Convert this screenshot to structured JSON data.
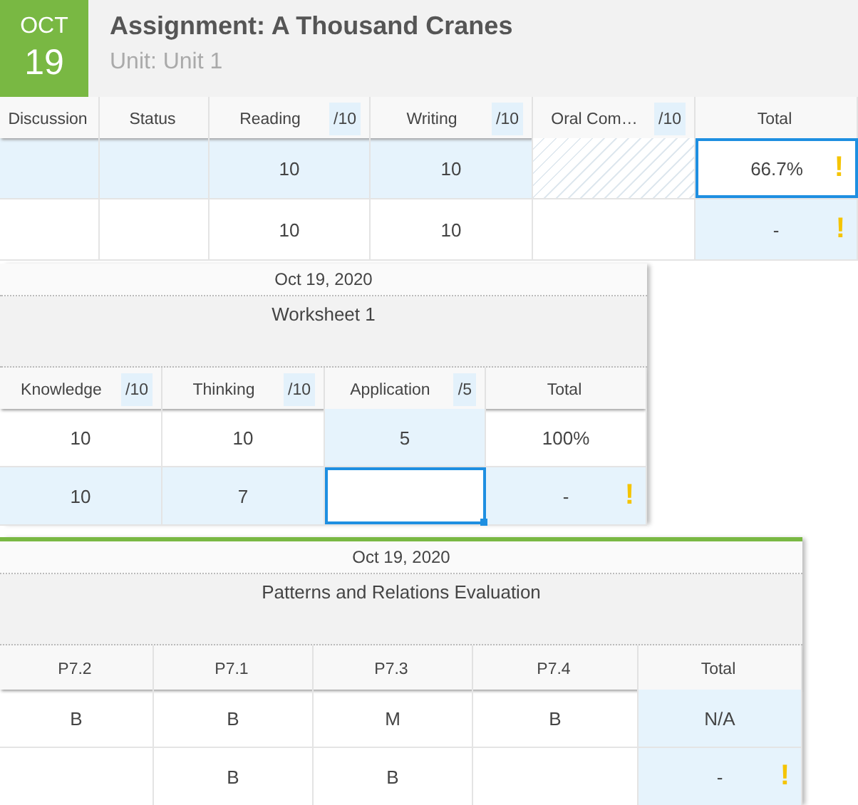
{
  "panels": [
    {
      "kind": "assignment",
      "selected": false,
      "month": "OCT",
      "day": "19",
      "title": "Assignment: A Thousand Cranes",
      "subtitle": "Unit: Unit 1",
      "columns": [
        {
          "label": "Discussion"
        },
        {
          "label": "Status"
        },
        {
          "label": "Reading",
          "max": "/10"
        },
        {
          "label": "Writing",
          "max": "/10"
        },
        {
          "label": "Oral Com…",
          "max": "/10"
        },
        {
          "label": "Total"
        }
      ],
      "rows": [
        {
          "selected": true,
          "cells": [
            {
              "kind": "normal"
            },
            {
              "kind": "normal"
            },
            {
              "value": "10",
              "kind": "normal"
            },
            {
              "value": "10",
              "kind": "normal"
            },
            {
              "kind": "hatched"
            },
            {
              "value": "66.7%",
              "kind": "focused",
              "flag": "!"
            }
          ]
        },
        {
          "selected": false,
          "cells": [
            {
              "kind": "normal"
            },
            {
              "kind": "normal"
            },
            {
              "value": "10",
              "kind": "normal"
            },
            {
              "value": "10",
              "kind": "normal"
            },
            {
              "kind": "normal"
            },
            {
              "value": "-",
              "kind": "highlighted",
              "flag": "!"
            }
          ]
        }
      ]
    },
    {
      "kind": "group",
      "selected": false,
      "date": "Oct 19, 2020",
      "title": "Worksheet 1",
      "columns": [
        {
          "label": "Knowledge",
          "max": "/10"
        },
        {
          "label": "Thinking",
          "max": "/10"
        },
        {
          "label": "Application",
          "max": "/5"
        },
        {
          "label": "Total"
        }
      ],
      "rows": [
        {
          "selected": false,
          "cells": [
            {
              "value": "10",
              "kind": "normal"
            },
            {
              "value": "10",
              "kind": "normal"
            },
            {
              "value": "5",
              "kind": "highlighted"
            },
            {
              "value": "100%",
              "kind": "normal"
            }
          ]
        },
        {
          "selected": true,
          "cells": [
            {
              "value": "10",
              "kind": "normal"
            },
            {
              "value": "7",
              "kind": "normal"
            },
            {
              "kind": "editing"
            },
            {
              "value": "-",
              "kind": "normal",
              "flag": "!"
            }
          ]
        }
      ]
    },
    {
      "kind": "group",
      "selected": true,
      "date": "Oct 19, 2020",
      "title": "Patterns and Relations Evaluation",
      "columns": [
        {
          "label": "P7.2"
        },
        {
          "label": "P7.1"
        },
        {
          "label": "P7.3"
        },
        {
          "label": "P7.4"
        },
        {
          "label": "Total"
        }
      ],
      "rows": [
        {
          "selected": false,
          "cells": [
            {
              "value": "B",
              "kind": "normal"
            },
            {
              "value": "B",
              "kind": "normal"
            },
            {
              "value": "M",
              "kind": "normal"
            },
            {
              "value": "B",
              "kind": "normal"
            },
            {
              "value": "N/A",
              "kind": "highlighted"
            }
          ]
        },
        {
          "selected": false,
          "cells": [
            {
              "kind": "normal"
            },
            {
              "value": "B",
              "kind": "normal"
            },
            {
              "value": "B",
              "kind": "normal"
            },
            {
              "kind": "normal"
            },
            {
              "value": "-",
              "kind": "highlighted",
              "flag": "!"
            }
          ]
        }
      ]
    }
  ]
}
